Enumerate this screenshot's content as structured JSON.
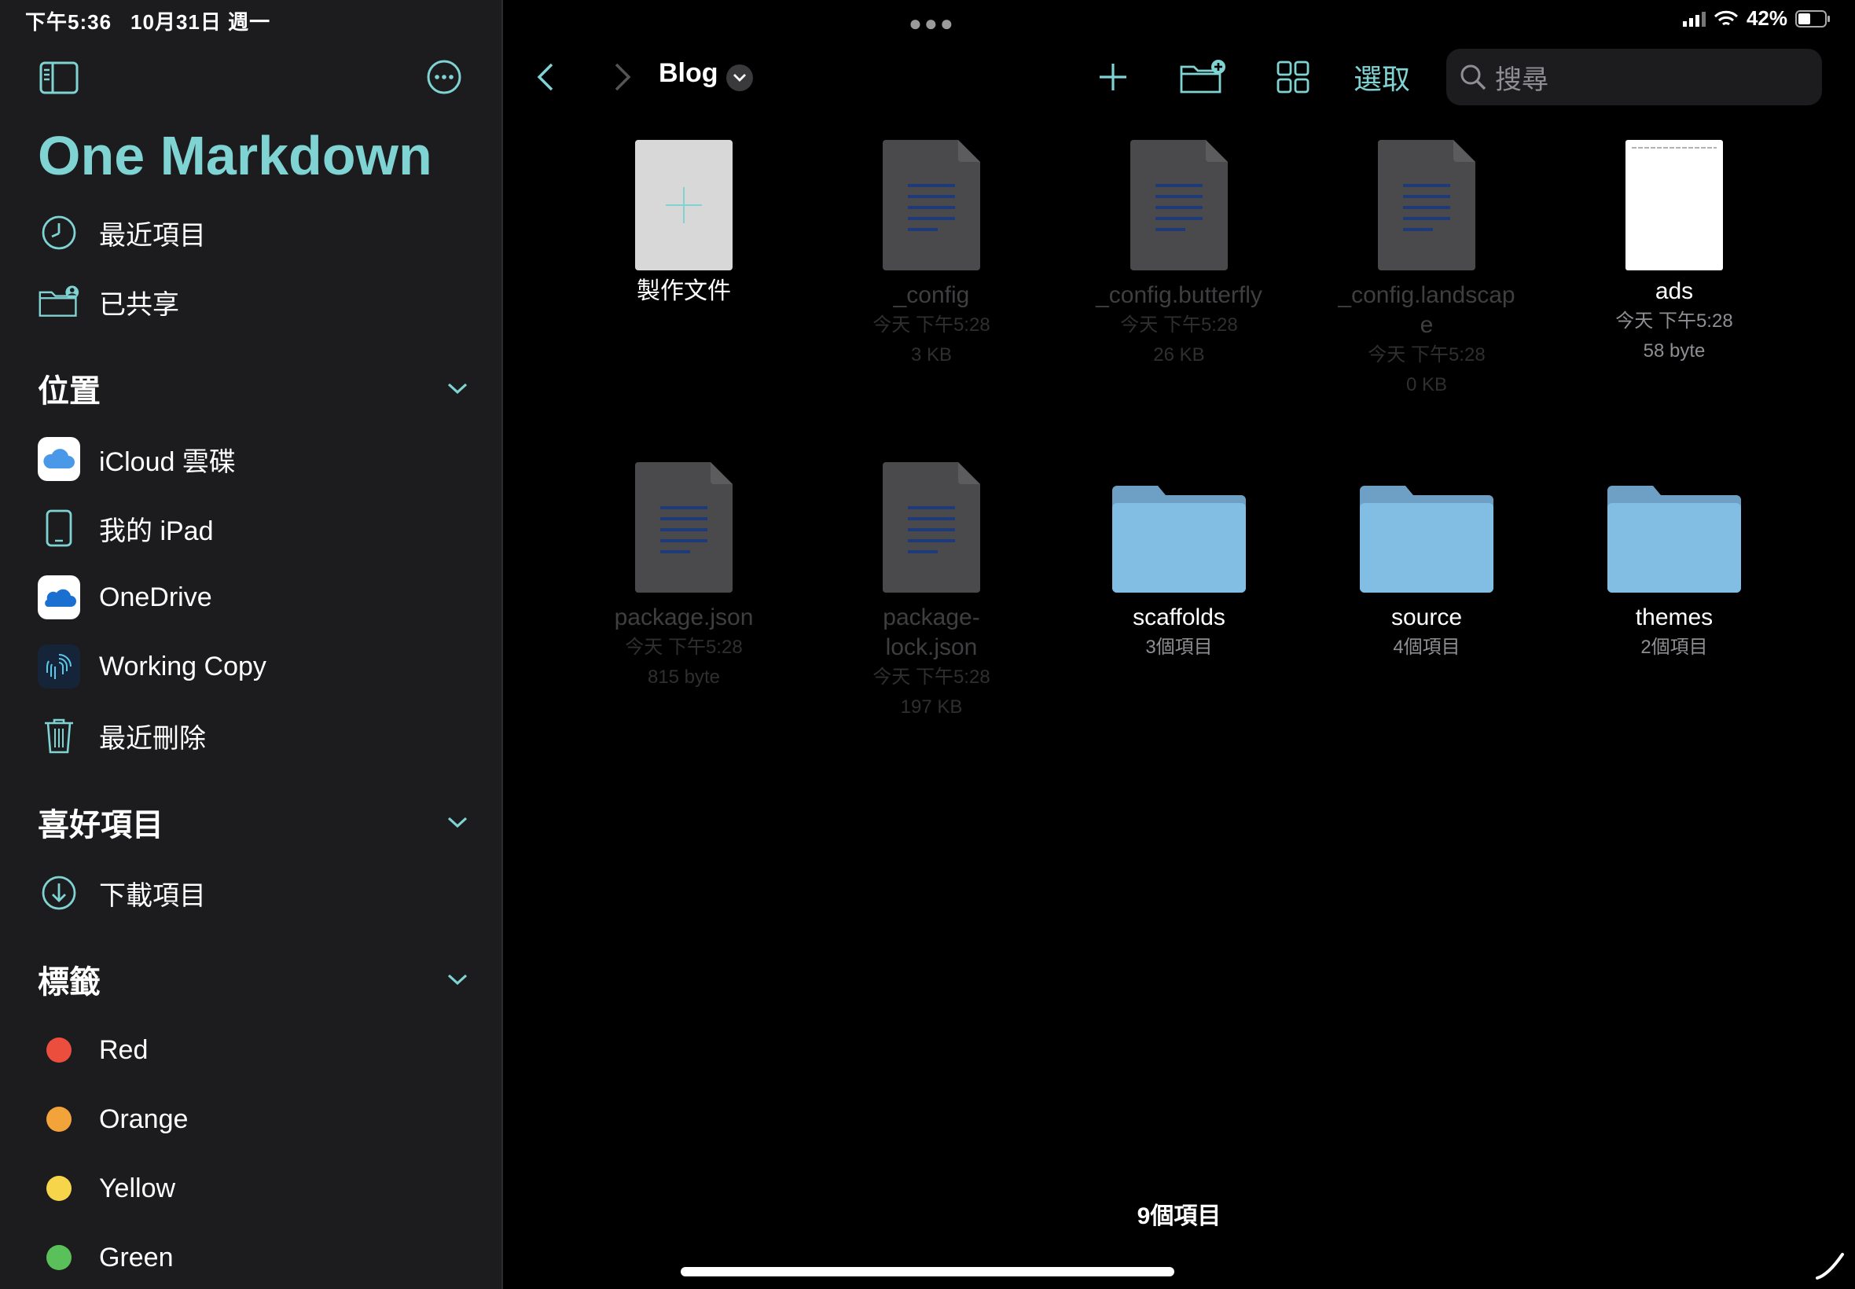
{
  "status": {
    "time": "下午5:36",
    "date": "10月31日 週一",
    "battery": "42%"
  },
  "sidebar": {
    "app_title": "One Markdown",
    "quick": [
      {
        "label": "最近項目",
        "icon": "clock-icon"
      },
      {
        "label": "已共享",
        "icon": "shared-folder-icon"
      }
    ],
    "sections": {
      "locations": {
        "title": "位置",
        "items": [
          {
            "label": "iCloud 雲碟",
            "icon": "icloud-icon"
          },
          {
            "label": "我的 iPad",
            "icon": "ipad-icon"
          },
          {
            "label": "OneDrive",
            "icon": "onedrive-icon"
          },
          {
            "label": "Working Copy",
            "icon": "working-copy-icon"
          },
          {
            "label": "最近刪除",
            "icon": "trash-icon"
          }
        ]
      },
      "favorites": {
        "title": "喜好項目",
        "items": [
          {
            "label": "下載項目",
            "icon": "download-icon"
          }
        ]
      },
      "tags": {
        "title": "標籤",
        "items": [
          {
            "label": "Red",
            "color": "#eb4e3d"
          },
          {
            "label": "Orange",
            "color": "#f2a33a"
          },
          {
            "label": "Yellow",
            "color": "#f7d54a"
          },
          {
            "label": "Green",
            "color": "#5ac15a"
          }
        ]
      }
    }
  },
  "toolbar": {
    "folder_title": "Blog",
    "select_label": "選取",
    "search_placeholder": "搜尋"
  },
  "files": [
    {
      "name": "製作文件",
      "kind": "create",
      "date": "",
      "size": ""
    },
    {
      "name": "_config",
      "kind": "doc",
      "date": "今天 下午5:28",
      "size": "3 KB"
    },
    {
      "name": "_config.butterfly",
      "kind": "doc",
      "date": "今天 下午5:28",
      "size": "26 KB"
    },
    {
      "name": "_config.landscap\ne",
      "kind": "doc",
      "date": "今天 下午5:28",
      "size": "0 KB"
    },
    {
      "name": "ads",
      "kind": "white-doc",
      "date": "今天 下午5:28",
      "size": "58 byte"
    },
    {
      "name": "package.json",
      "kind": "doc",
      "date": "今天 下午5:28",
      "size": "815 byte"
    },
    {
      "name": "package-\nlock.json",
      "kind": "doc",
      "date": "今天 下午5:28",
      "size": "197 KB"
    },
    {
      "name": "scaffolds",
      "kind": "folder",
      "date": "",
      "size": "3個項目"
    },
    {
      "name": "source",
      "kind": "folder",
      "date": "",
      "size": "4個項目"
    },
    {
      "name": "themes",
      "kind": "folder",
      "date": "",
      "size": "2個項目"
    }
  ],
  "footer": {
    "item_count": "9個項目"
  },
  "colors": {
    "accent": "#7fd3d3",
    "sidebar_bg": "#1c1c1e",
    "folder": "#7fb6dc"
  }
}
